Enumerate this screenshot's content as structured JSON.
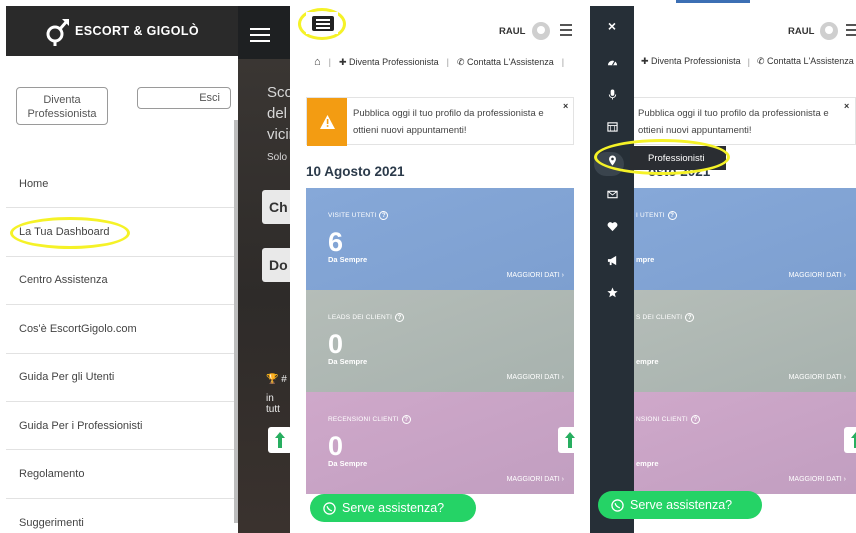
{
  "panel1": {
    "logo_text": "ESCORT & GIGOLÒ",
    "btn_professionista": "Diventa Professionista",
    "btn_esci": "Esci",
    "menu": [
      {
        "label": "Home"
      },
      {
        "label": "La Tua Dashboard",
        "highlighted": true
      },
      {
        "label": "Centro Assistenza"
      },
      {
        "label": "Cos'è EscortGigolo.com"
      },
      {
        "label": "Guida Per gli Utenti"
      },
      {
        "label": "Guida Per i Professionisti"
      },
      {
        "label": "Regolamento"
      },
      {
        "label": "Suggerimenti"
      }
    ],
    "bg_text": {
      "l1": "Sco",
      "l2": "del",
      "l3": "vicin",
      "l4": "Solo",
      "box1": "Ch",
      "box2": "Do",
      "cup": "#",
      "cup2": "in tutt"
    }
  },
  "panel2": {
    "user_name": "RAUL",
    "nav": {
      "diventa": "Diventa Professionista",
      "contatta": "Contatta L'Assistenza"
    },
    "banner": {
      "line1": "Pubblica oggi il tuo profilo da professionista e",
      "line2": "ottieni nuovi appuntamenti!",
      "close": "×"
    },
    "date": "10 Agosto 2021",
    "stats": [
      {
        "label": "Visite utenti",
        "value": "6",
        "sub": "Da Sempre",
        "more": "Maggiori dati ›",
        "color": "#7d9fd0"
      },
      {
        "label": "Leads dei clienti",
        "value": "0",
        "sub": "Da Sempre",
        "more": "Maggiori dati ›",
        "color": "#a7b2ae"
      },
      {
        "label": "Recensioni clienti",
        "value": "0",
        "sub": "Da Sempre",
        "more": "Maggiori dati ›",
        "color": "#c19ec0"
      }
    ],
    "whatsapp_label": "Serve assistenza?"
  },
  "panel3": {
    "user_name": "RAUL",
    "nav": {
      "diventa": "Diventa Professionista",
      "contatta": "Contatta L'Assistenza"
    },
    "banner": {
      "line1": "Pubblica oggi il tuo profilo da professionista e",
      "line2": "ottieni nuovi appuntamenti!",
      "close": "×"
    },
    "tooltip": "Professionisti",
    "date_fragment": "osto 2021",
    "stats": [
      {
        "label": "I UTENTI",
        "sub": "mpre",
        "more": "Maggiori dati ›"
      },
      {
        "label": "S DEI CLIENTI",
        "sub": "empre",
        "more": "Maggiori dati ›"
      },
      {
        "label": "NSIONI CLIENTI",
        "sub": "empre",
        "more": "Maggiori dati ›"
      }
    ],
    "whatsapp_label": "Serve assistenza?",
    "rail_icons": [
      "close-icon",
      "dashboard-icon",
      "microphone-icon",
      "calendar-icon",
      "map-marker-icon",
      "envelope-icon",
      "heart-icon",
      "megaphone-icon",
      "star-icon"
    ]
  },
  "colors": {
    "accent_highlight": "#f5f227",
    "whatsapp": "#25d366",
    "banner_warning": "#f39c12",
    "rail_bg": "#262f37"
  }
}
